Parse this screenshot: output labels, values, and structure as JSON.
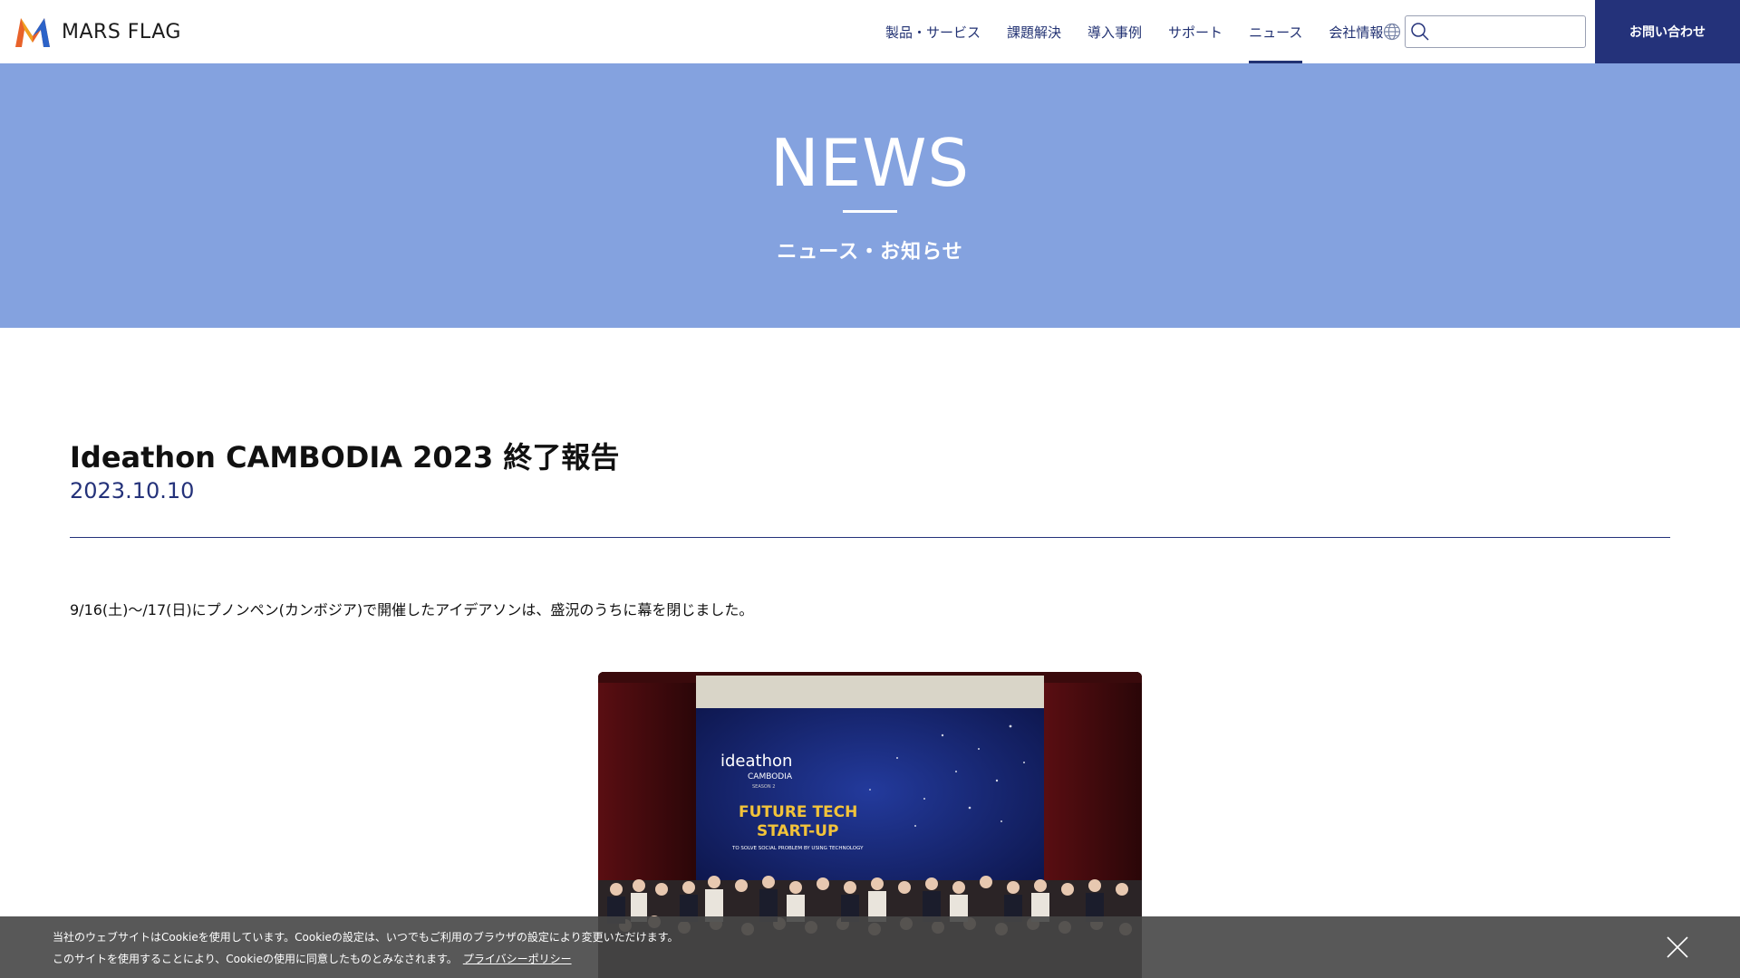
{
  "header": {
    "logo_text": "MARS FLAG",
    "nav": [
      {
        "label": "製品・サービス",
        "active": false
      },
      {
        "label": "課題解決",
        "active": false
      },
      {
        "label": "導入事例",
        "active": false
      },
      {
        "label": "サポート",
        "active": false
      },
      {
        "label": "ニュース",
        "active": true
      },
      {
        "label": "会社情報",
        "active": false
      }
    ],
    "search_value": "",
    "contact_label": "お問い合わせ"
  },
  "hero": {
    "title": "NEWS",
    "subtitle": "ニュース・お知らせ"
  },
  "article": {
    "title": "Ideathon CAMBODIA 2023 終了報告",
    "date": "2023.10.10",
    "body": "9/16(土)〜/17(日)にプノンペン(カンボジア)で開催したアイデアソンは、盛況のうちに幕を閉じました。",
    "photo": {
      "event_title": "ideathon",
      "event_location": "CAMBODIA",
      "event_season": "SEASON 2",
      "headline_line1": "FUTURE TECH",
      "headline_line2": "START-UP",
      "tagline": "TO SOLVE SOCIAL PROBLEM BY USING TECHNOLOGY"
    }
  },
  "cookie": {
    "line1": "当社のウェブサイトはCookieを使用しています。Cookieの設定は、いつでもご利用のブラウザの設定により変更いただけます。",
    "line2": "このサイトを使用することにより、Cookieの使用に同意したものとみなされます。",
    "link": "プライバシーポリシー"
  },
  "colors": {
    "brand_navy": "#24327a",
    "hero_blue": "#84a2df",
    "cookie_bg": "#464646"
  }
}
